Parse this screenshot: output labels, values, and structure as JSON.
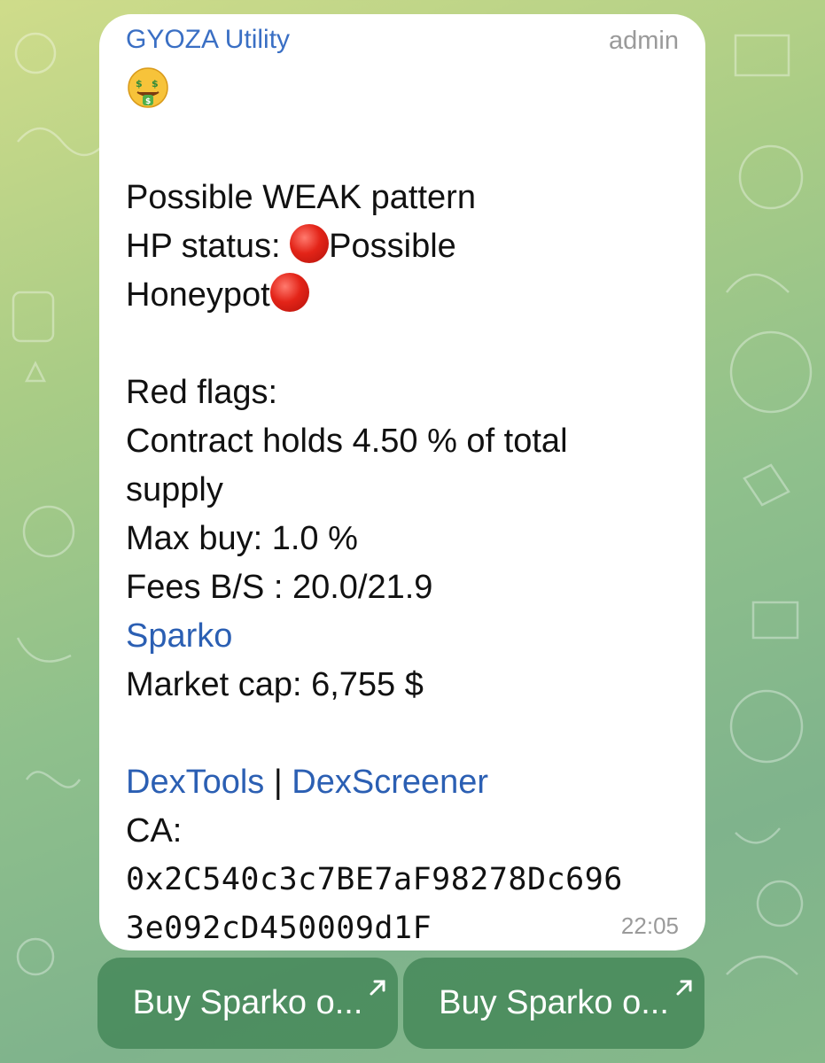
{
  "message": {
    "sender": "GYOZA Utility",
    "role": "admin",
    "emoji_icon": "money-mouth-face-icon",
    "lines": {
      "pattern": "Possible WEAK pattern",
      "hp_label": "HP status: ",
      "hp_value": "Possible",
      "hp_value2": "Honeypot",
      "red_flags": "Red flags:",
      "contract_holds": "Contract holds 4.50 % of total",
      "supply": "supply",
      "max_buy": "Max buy: 1.0 %",
      "fees": "Fees B/S : 20.0/21.9",
      "token_link": "Sparko",
      "market_cap": "Market cap: 6,755 $",
      "dextools": "DexTools",
      "separator": " | ",
      "dexscreener": "DexScreener",
      "ca_label": "CA:",
      "ca_line1": "0x2C540c3c7BE7aF98278Dc696",
      "ca_line2": "3e092cD450009d1F"
    },
    "time": "22:05"
  },
  "buttons": [
    {
      "label": "Buy Sparko o...",
      "icon": "external-arrow-icon"
    },
    {
      "label": "Buy Sparko o...",
      "icon": "external-arrow-icon"
    }
  ],
  "colors": {
    "link": "#2b5fb3",
    "sender": "#3a6fc4",
    "button_bg": "#408454",
    "alert_red": "#e32418"
  }
}
